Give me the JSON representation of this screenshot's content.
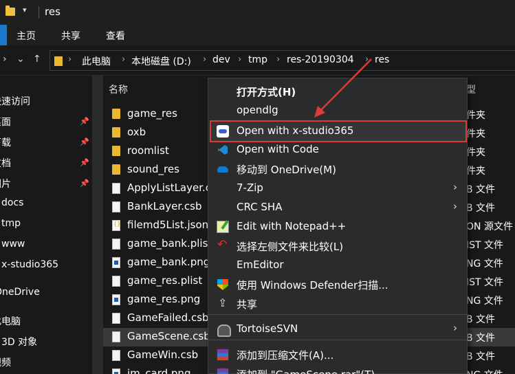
{
  "window": {
    "title": "res",
    "quick_access_arrow": "▾"
  },
  "ribbon": {
    "tabs": [
      "主页",
      "共享",
      "查看"
    ]
  },
  "nav": {
    "back": "›",
    "down": "⌄",
    "up": "↑"
  },
  "breadcrumb": [
    "此电脑",
    "本地磁盘 (D:)",
    "dev",
    "tmp",
    "res-20190304",
    "res"
  ],
  "breadcrumb_sep": "›",
  "navpane": {
    "items": [
      "快速访问",
      "桌面",
      "下载",
      "文档",
      "图片",
      "docs",
      "tmp",
      "www",
      "x-studio365",
      "OneDrive",
      "此电脑",
      "3D 对象",
      "视频"
    ],
    "pin_icon": "pin-icon"
  },
  "columns": {
    "name": "名称",
    "type": "型"
  },
  "files": [
    {
      "name": "game_res",
      "type": "件夹",
      "icon": "folder"
    },
    {
      "name": "oxb",
      "type": "件夹",
      "icon": "folder"
    },
    {
      "name": "roomlist",
      "type": "件夹",
      "icon": "folder"
    },
    {
      "name": "sound_res",
      "type": "件夹",
      "icon": "folder"
    },
    {
      "name": "ApplyListLayer.c",
      "type": "B 文件",
      "icon": "doc"
    },
    {
      "name": "BankLayer.csb",
      "type": "B 文件",
      "icon": "doc"
    },
    {
      "name": "filemd5List.json",
      "type": "ON 源文件",
      "icon": "json"
    },
    {
      "name": "game_bank.plist",
      "type": "IST 文件",
      "icon": "doc"
    },
    {
      "name": "game_bank.png",
      "type": "NG 文件",
      "icon": "png"
    },
    {
      "name": "game_res.plist",
      "type": "IST 文件",
      "icon": "doc"
    },
    {
      "name": "game_res.png",
      "type": "NG 文件",
      "icon": "png"
    },
    {
      "name": "GameFailed.csb",
      "type": "B 文件",
      "icon": "doc"
    },
    {
      "name": "GameScene.csb",
      "type": "B 文件",
      "icon": "doc",
      "selected": true
    },
    {
      "name": "GameWin.csb",
      "type": "B 文件",
      "icon": "doc"
    },
    {
      "name": "im_card.png",
      "type": "NG 文件",
      "icon": "png"
    }
  ],
  "context_menu": {
    "items": [
      {
        "label": "打开方式(H)",
        "bold": true
      },
      {
        "label": "opendlg"
      },
      {
        "label": "Open with x-studio365",
        "icon": "x-studio-icon",
        "highlighted": true
      },
      {
        "label": "Open with Code",
        "icon": "vscode-icon"
      },
      {
        "label": "移动到 OneDrive(M)",
        "icon": "onedrive-icon"
      },
      {
        "label": "7-Zip",
        "submenu": true
      },
      {
        "label": "CRC SHA",
        "submenu": true
      },
      {
        "label": "Edit with Notepad++",
        "icon": "notepad-icon"
      },
      {
        "label": "选择左侧文件来比较(L)",
        "icon": "compare-icon"
      },
      {
        "label": "EmEditor"
      },
      {
        "label": "使用 Windows Defender扫描...",
        "icon": "defender-icon"
      },
      {
        "label": "共享",
        "icon": "share-icon"
      },
      {
        "label": "TortoiseSVN",
        "icon": "tortoise-icon",
        "submenu": true
      },
      {
        "label": "添加到压缩文件(A)...",
        "icon": "rar-icon"
      },
      {
        "label": "添加到 \"GameScene.rar\"(T)",
        "icon": "rar-icon"
      }
    ],
    "submenu_arrow": "›"
  },
  "colors": {
    "highlight_border": "#d93c3c",
    "accent": "#1979ca",
    "folder": "#e8b830"
  }
}
